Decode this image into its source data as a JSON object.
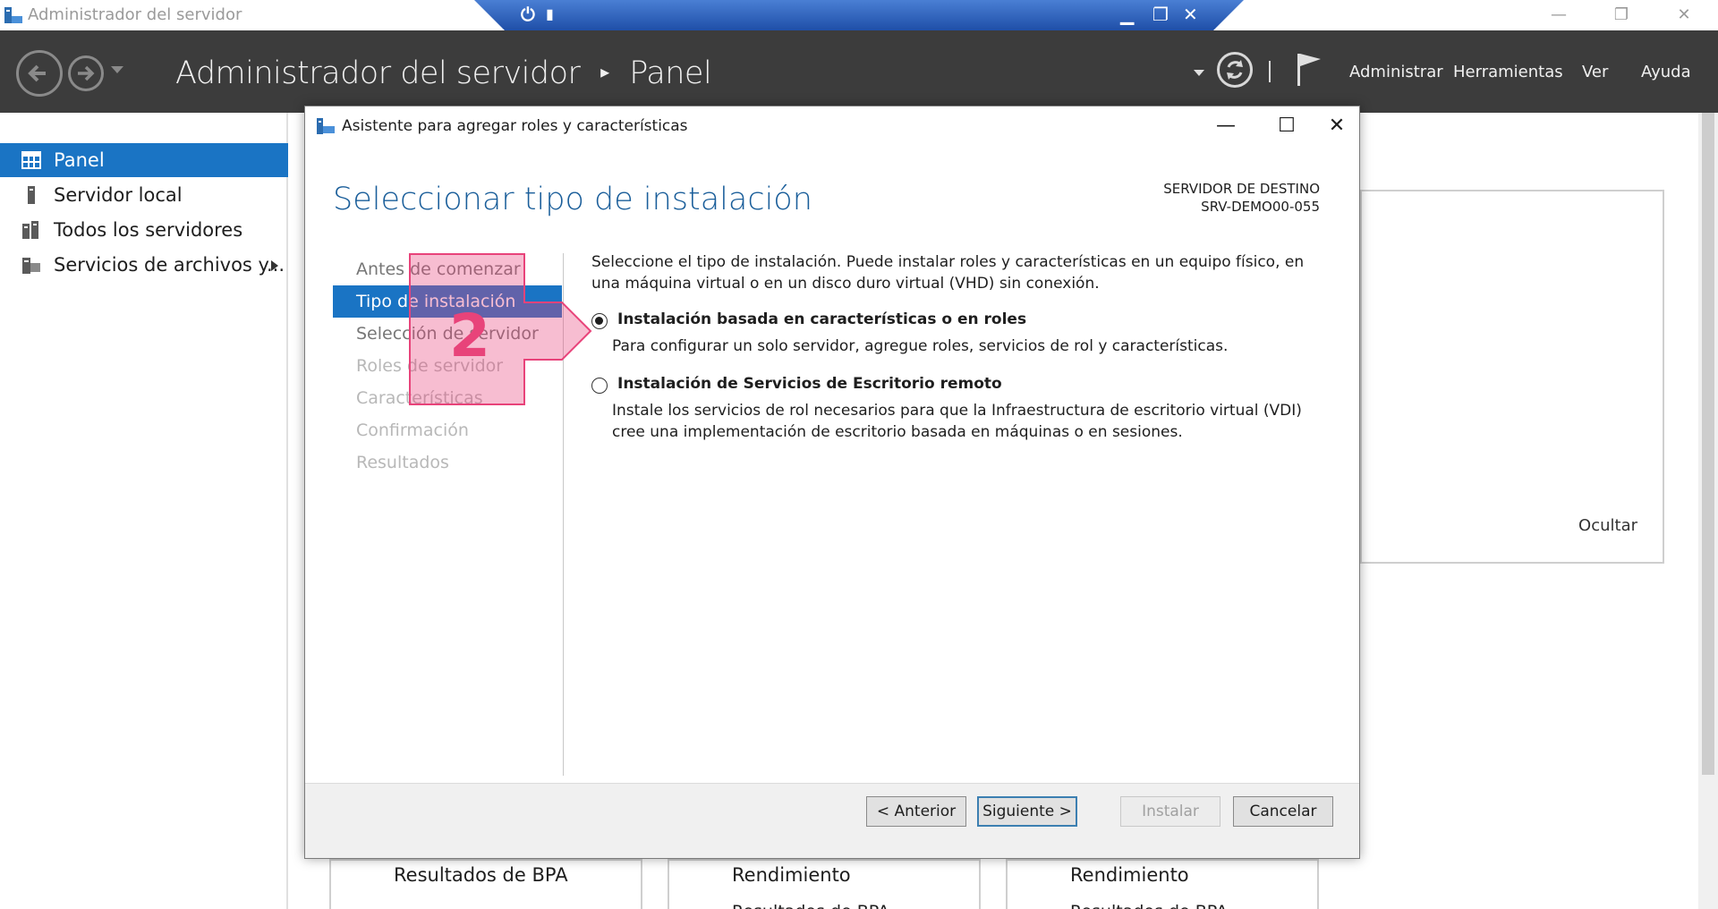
{
  "window": {
    "title": "Administrador del servidor"
  },
  "header": {
    "title": "Administrador del servidor",
    "separator": "▸",
    "section": "Panel",
    "menu": [
      "Administrar",
      "Herramientas",
      "Ver",
      "Ayuda"
    ]
  },
  "sidebar": {
    "items": [
      {
        "label": "Panel",
        "icon": "dashboard-icon",
        "selected": true
      },
      {
        "label": "Servidor local",
        "icon": "server-icon",
        "selected": false
      },
      {
        "label": "Todos los servidores",
        "icon": "servers-icon",
        "selected": false
      },
      {
        "label": "Servicios de archivos y...",
        "icon": "file-services-icon",
        "selected": false,
        "has_submenu": true
      }
    ]
  },
  "background": {
    "hide_label": "Ocultar",
    "tiles": [
      {
        "title": "Resultados de BPA",
        "sub": ""
      },
      {
        "title": "Rendimiento",
        "sub": "Resultados de BPA"
      },
      {
        "title": "Rendimiento",
        "sub": "Resultados de BPA"
      }
    ]
  },
  "dialog": {
    "title": "Asistente para agregar roles y características",
    "heading": "Seleccionar tipo de instalación",
    "dest_label": "SERVIDOR DE DESTINO",
    "dest_server": "SRV-DEMO00-055",
    "steps": [
      {
        "label": "Antes de comenzar",
        "state": "done"
      },
      {
        "label": "Tipo de instalación",
        "state": "current"
      },
      {
        "label": "Selección de servidor",
        "state": "done"
      },
      {
        "label": "Roles de servidor",
        "state": "disabled"
      },
      {
        "label": "Características",
        "state": "disabled"
      },
      {
        "label": "Confirmación",
        "state": "disabled"
      },
      {
        "label": "Resultados",
        "state": "disabled"
      }
    ],
    "description": "Seleccione el tipo de instalación. Puede instalar roles y características en un equipo físico, en una máquina virtual o en un disco duro virtual (VHD) sin conexión.",
    "options": [
      {
        "label": "Instalación basada en características o en roles",
        "desc": "Para configurar un solo servidor, agregue roles, servicios de rol y características.",
        "selected": true
      },
      {
        "label": "Instalación de Servicios de Escritorio remoto",
        "desc": "Instale los servicios de rol necesarios para que la Infraestructura de escritorio virtual (VDI) cree una implementación de escritorio basada en máquinas o en sesiones.",
        "selected": false
      }
    ],
    "buttons": {
      "prev": "< Anterior",
      "next": "Siguiente >",
      "install": "Instalar",
      "cancel": "Cancelar"
    }
  },
  "annotation": {
    "number": "2",
    "color": "#e8437a"
  }
}
